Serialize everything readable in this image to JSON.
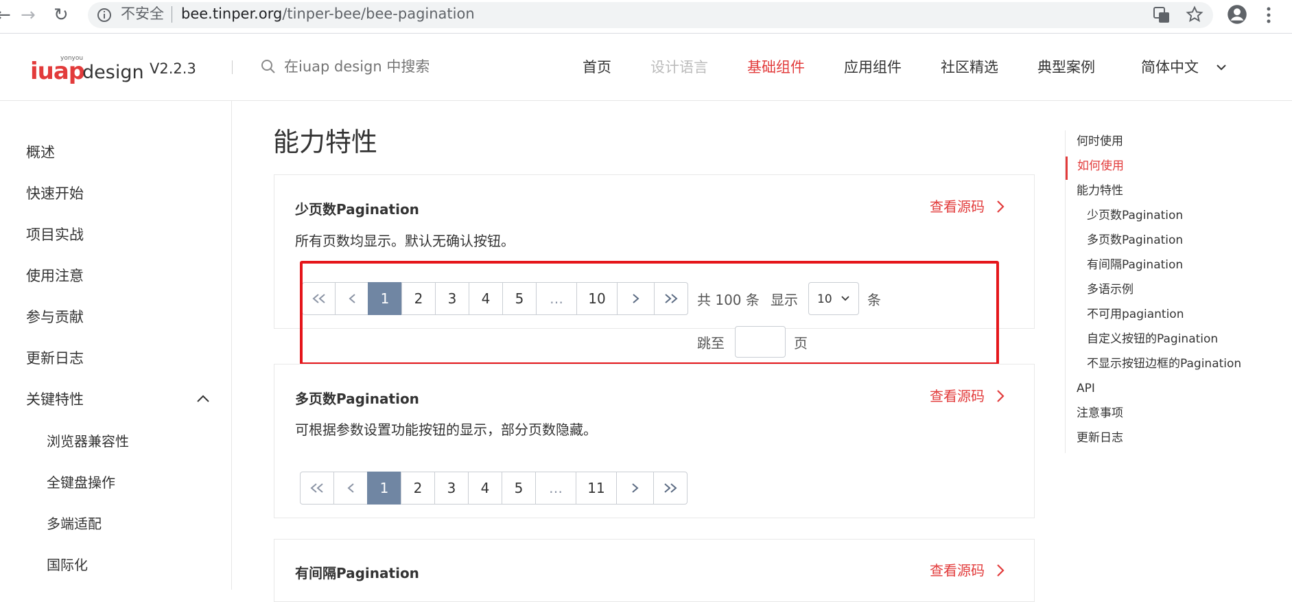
{
  "browser": {
    "back_glyph": "←",
    "forward_glyph": "→",
    "reload_glyph": "↻",
    "security_label": "不安全",
    "url_host": "bee.tinper.org",
    "url_path": "/tinper-bee/bee-pagination"
  },
  "header": {
    "logo_small": "yonyou",
    "logo_main": "iuap",
    "logo_suffix": "design",
    "version": "V2.2.3",
    "search_placeholder": "在iuap design 中搜索",
    "nav": [
      "首页",
      "设计语言",
      "基础组件",
      "应用组件",
      "社区精选",
      "典型案例"
    ],
    "language": "简体中文"
  },
  "sidebar": {
    "items": [
      "概述",
      "快速开始",
      "项目实战",
      "使用注意",
      "参与贡献",
      "更新日志",
      "关键特性"
    ],
    "sub_items": [
      "浏览器兼容性",
      "全键盘操作",
      "多端适配",
      "国际化"
    ]
  },
  "main": {
    "page_title": "能力特性",
    "source_label": "查看源码",
    "demos": [
      {
        "title": "少页数Pagination",
        "desc": "所有页数均显示。默认无确认按钮。",
        "pages": [
          "1",
          "2",
          "3",
          "4",
          "5",
          "…",
          "10"
        ],
        "total_text": "共 100 条",
        "show_label": "显示",
        "page_size": "10",
        "unit_label": "条",
        "jump_label": "跳至",
        "page_label": "页"
      },
      {
        "title": "多页数Pagination",
        "desc": "可根据参数设置功能按钮的显示，部分页数隐藏。",
        "pages": [
          "1",
          "2",
          "3",
          "4",
          "5",
          "…",
          "11"
        ]
      },
      {
        "title": "有间隔Pagination"
      }
    ]
  },
  "toc": {
    "items": [
      "何时使用",
      "如何使用",
      "能力特性",
      "少页数Pagination",
      "多页数Pagination",
      "有间隔Pagination",
      "多语示例",
      "不可用pagiantion",
      "自定义按钮的Pagination",
      "不显示按钮边框的Pagination",
      "API",
      "注意事项",
      "更新日志"
    ],
    "active_index": 1
  },
  "colors": {
    "accent": "#e23b3b",
    "active_page": "#7086a3",
    "highlight_box": "#e5161b"
  }
}
